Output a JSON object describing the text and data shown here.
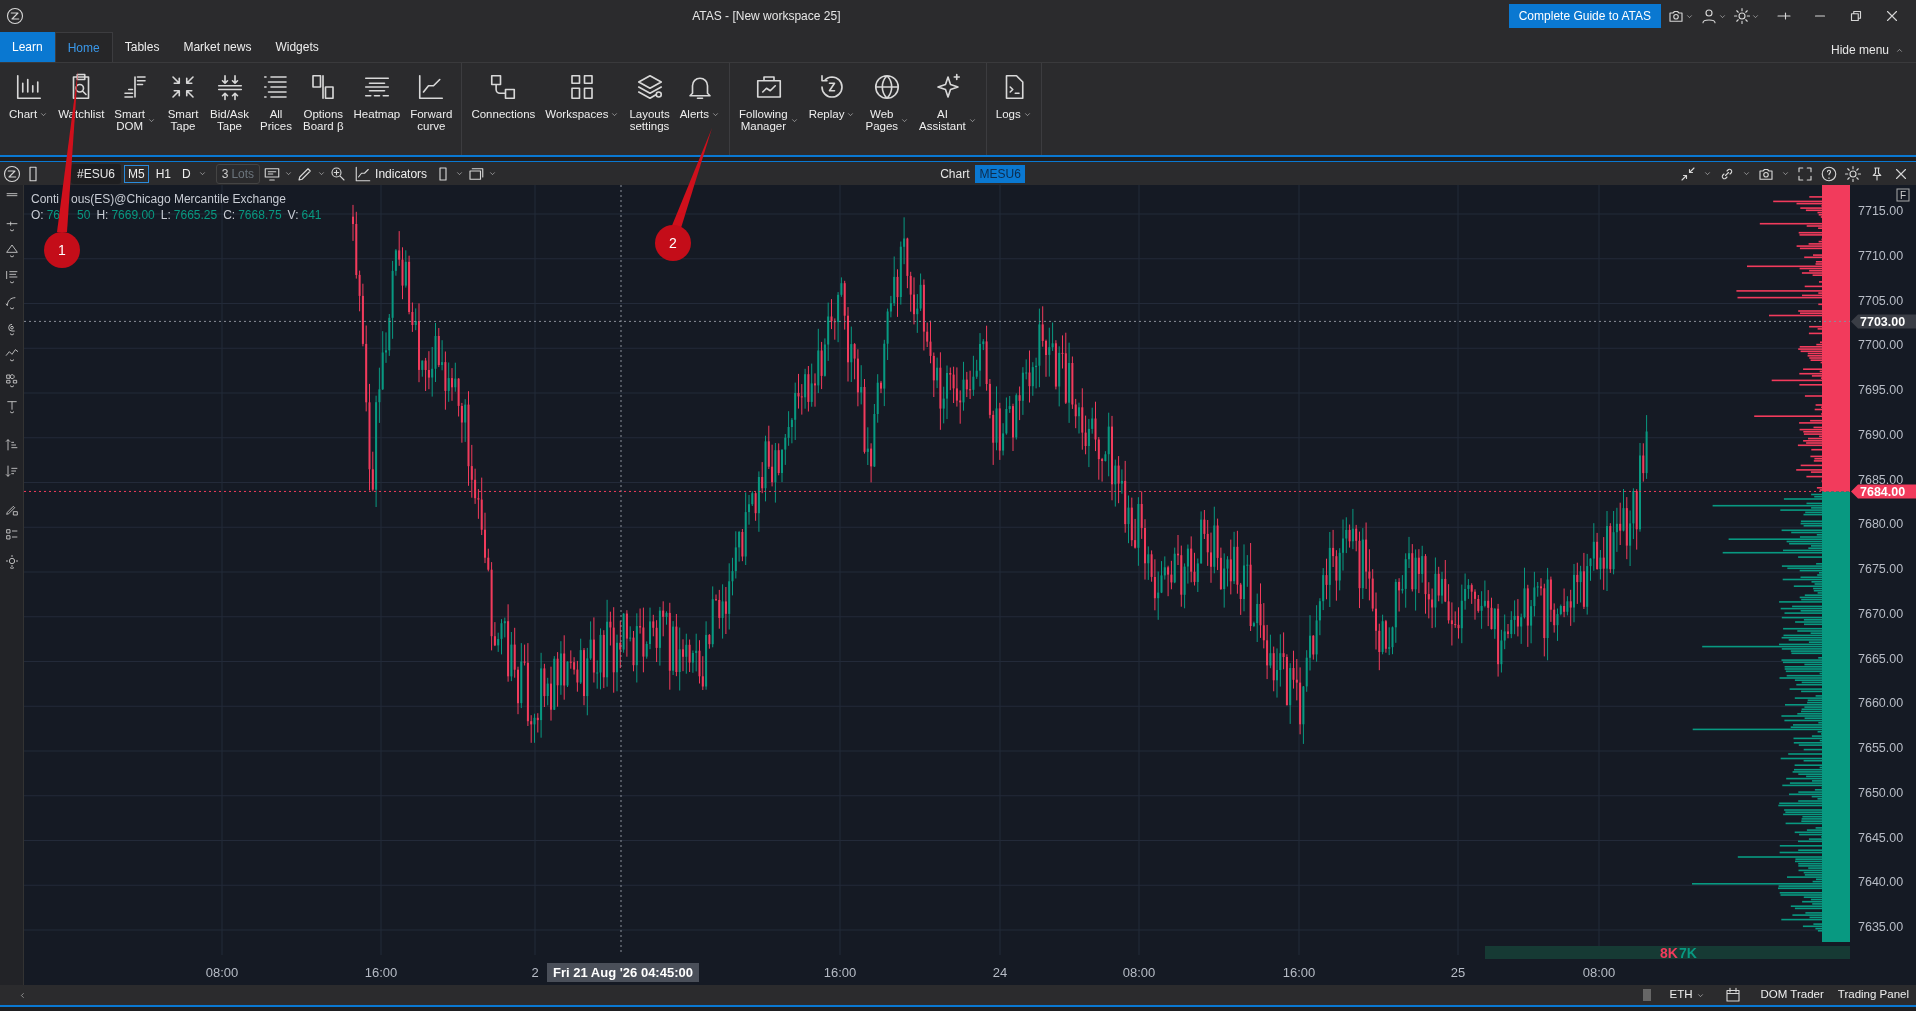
{
  "window": {
    "title": "ATAS - [New workspace 25]",
    "guide_button": "Complete Guide to ATAS"
  },
  "menu_tabs": [
    {
      "label": "Learn",
      "kind": "accent",
      "selected": false
    },
    {
      "label": "Home",
      "kind": "tab",
      "selected": true
    },
    {
      "label": "Tables",
      "kind": "tab",
      "selected": false
    },
    {
      "label": "Market news",
      "kind": "tab",
      "selected": false
    },
    {
      "label": "Widgets",
      "kind": "tab",
      "selected": false
    }
  ],
  "hide_menu": "Hide menu",
  "ribbon_groups": [
    {
      "items": [
        {
          "label": "Chart",
          "dropdown": true
        },
        {
          "label": "Watchlist",
          "dropdown": false
        },
        {
          "label": "Smart\nDOM",
          "dropdown": true
        },
        {
          "label": "Smart\nTape",
          "dropdown": false
        },
        {
          "label": "Bid/Ask\nTape",
          "dropdown": false
        },
        {
          "label": "All\nPrices",
          "dropdown": false
        },
        {
          "label": "Options\nBoard β",
          "dropdown": false
        },
        {
          "label": "Heatmap",
          "dropdown": false
        },
        {
          "label": "Forward\ncurve",
          "dropdown": false
        }
      ]
    },
    {
      "items": [
        {
          "label": "Connections",
          "dropdown": false
        },
        {
          "label": "Workspaces",
          "dropdown": true
        },
        {
          "label": "Layouts\nsettings",
          "dropdown": false
        },
        {
          "label": "Alerts",
          "dropdown": true
        }
      ]
    },
    {
      "items": [
        {
          "label": "Following\nManager",
          "dropdown": true
        },
        {
          "label": "Replay",
          "dropdown": true
        },
        {
          "label": "Web\nPages",
          "dropdown": true
        },
        {
          "label": "AI\nAssistant",
          "dropdown": true
        }
      ]
    },
    {
      "items": [
        {
          "label": "Logs",
          "dropdown": true
        }
      ]
    }
  ],
  "chart_toolbar": {
    "symbol": "#ESU6",
    "timeframes": [
      {
        "label": "M5",
        "selected": true
      },
      {
        "label": "H1",
        "selected": false
      },
      {
        "label": "D",
        "selected": false
      }
    ],
    "lots_value": "3",
    "lots_unit": "Lots",
    "indicators": "Indicators"
  },
  "chart_header": {
    "title": "Chart",
    "instrument": "MESU6"
  },
  "legend": {
    "name_parts": [
      "Conti",
      "ous(ES)@Chicago Mercantile Exchange"
    ],
    "open_label": "O:",
    "open_parts": [
      "76",
      "50"
    ],
    "values": [
      {
        "label": "H:",
        "value": "7669.00"
      },
      {
        "label": "L:",
        "value": "7665.25"
      },
      {
        "label": "C:",
        "value": "7668.75"
      },
      {
        "label": "V:",
        "value": "641"
      }
    ]
  },
  "price_axis": [
    "7715.00",
    "7710.00",
    "7705.00",
    "7700.00",
    "7695.00",
    "7690.00",
    "7685.00",
    "7680.00",
    "7675.00",
    "7670.00",
    "7665.00",
    "7660.00",
    "7655.00",
    "7650.00",
    "7645.00",
    "7640.00",
    "7635.00"
  ],
  "price_markers": [
    {
      "label": "7703.00",
      "kind": "crosshair"
    },
    {
      "label": "7684.00",
      "kind": "last"
    }
  ],
  "profile_flag": "F",
  "time_axis": [
    "08:00",
    "16:00",
    "2",
    "16:00",
    "24",
    "08:00",
    "16:00",
    "25",
    "08:00"
  ],
  "crosshair_time": "Fri 21 Aug '26 04:45:00",
  "volume_labels": [
    {
      "label": "8K",
      "kind": "sell"
    },
    {
      "label": "7K",
      "kind": "buy"
    }
  ],
  "annotations": [
    "1",
    "2"
  ],
  "status_bar": {
    "session": "ETH",
    "buttons": [
      "DOM Trader",
      "Trading Panel"
    ]
  }
}
